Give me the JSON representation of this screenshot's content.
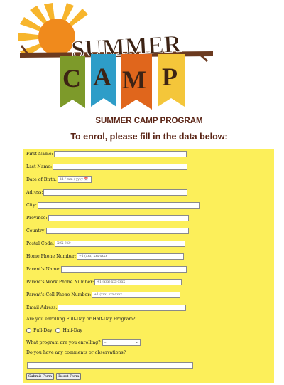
{
  "logo": {
    "word1": "SUMMER",
    "word2": [
      "C",
      "A",
      "M",
      "P"
    ]
  },
  "header": {
    "title": "SUMMER CAMP PROGRAM",
    "subtitle": "To enrol, please fill in the data below:"
  },
  "form": {
    "first_name": "First Name:",
    "last_name": "Last Name:",
    "dob": "Date of Birth:",
    "dob_placeholder": "dd / mm / yyyy",
    "address": "Adress:",
    "city": "City:",
    "province": "Province:",
    "country": "Country:",
    "postal_code": "Postal Code:",
    "postal_placeholder": "X9X-9X9",
    "home_phone": "Home Phone Number:",
    "phone_placeholder": "+1 (xxx) xxx-xxxx",
    "parent_name": "Parent's Name:",
    "parent_work_phone": "Parent's Work Phone Number:",
    "parent_cell_phone": "Parent's Cell Phone Number:",
    "email": "Email Adress:",
    "day_question": "Are you enrolling Full-Day or Half-Day Program?",
    "full_day": "Full-Day",
    "half_day": "Half-Day",
    "program_question": "What program are you enrolling?",
    "program_selected": "...",
    "comments_question": "Do you have any comments or observations?",
    "submit": "Submit Form",
    "reset": "Reset Form"
  }
}
